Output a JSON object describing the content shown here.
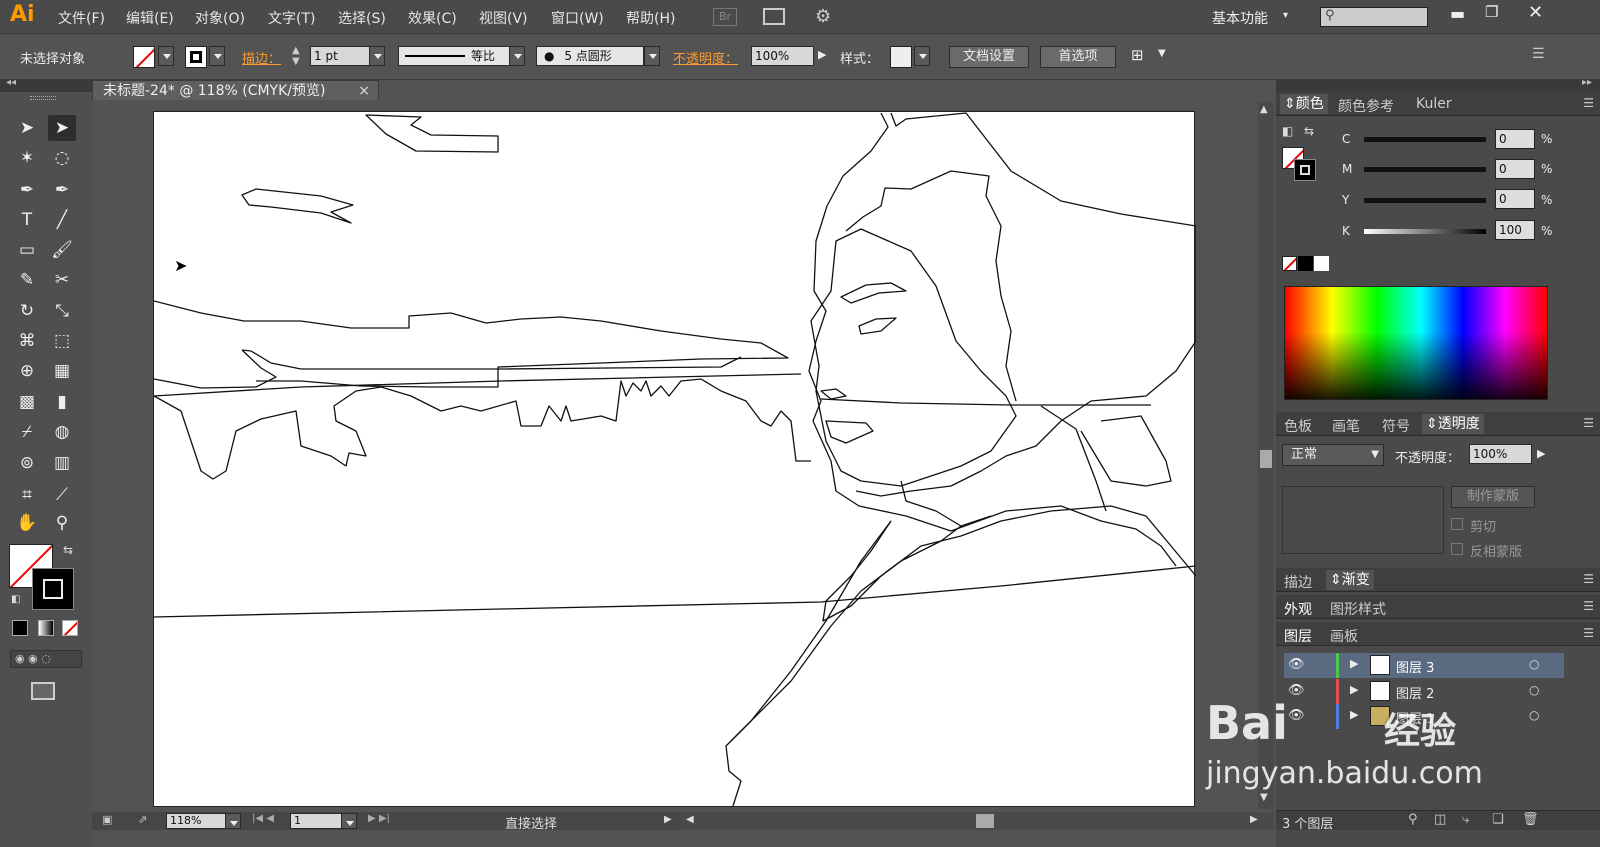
{
  "app": {
    "logo": "Ai"
  },
  "menu": [
    "文件(F)",
    "编辑(E)",
    "对象(O)",
    "文字(T)",
    "选择(S)",
    "效果(C)",
    "视图(V)",
    "窗口(W)",
    "帮助(H)"
  ],
  "menubar_right": {
    "workspace": "基本功能",
    "bridge": "Br"
  },
  "control": {
    "selection_status": "未选择对象",
    "stroke_label": "描边：",
    "stroke_weight": "1 pt",
    "profile": "等比",
    "brush": "5 点圆形",
    "opacity_label": "不透明度：",
    "opacity_value": "100%",
    "style_label": "样式：",
    "doc_setup": "文档设置",
    "preferences": "首选项"
  },
  "document": {
    "tab_title": "未标题-24* @ 118% (CMYK/预览)",
    "tab_close": "×"
  },
  "status": {
    "zoom": "118%",
    "artboard_num": "1",
    "tool_name": "直接选择"
  },
  "color_panel": {
    "tabs": [
      "颜色",
      "颜色参考",
      "Kuler"
    ],
    "channels": [
      {
        "label": "C",
        "value": "0"
      },
      {
        "label": "M",
        "value": "0"
      },
      {
        "label": "Y",
        "value": "0"
      },
      {
        "label": "K",
        "value": "100"
      }
    ],
    "percent": "%"
  },
  "transparency_panel": {
    "tabs": [
      "色板",
      "画笔",
      "符号",
      "透明度"
    ],
    "blend_mode": "正常",
    "opacity_label": "不透明度：",
    "opacity_value": "100%",
    "make_mask": "制作蒙版",
    "clip": "剪切",
    "invert_mask": "反相蒙版"
  },
  "stroke_panel": {
    "tabs": [
      "描边",
      "渐变"
    ]
  },
  "appearance_panel": {
    "tabs": [
      "外观",
      "图形样式"
    ]
  },
  "layers_panel": {
    "tabs": [
      "图层",
      "画板"
    ],
    "layers": [
      {
        "name": "图层 3",
        "color": "#4fc64f",
        "selected": true
      },
      {
        "name": "图层 2",
        "color": "#e05050",
        "selected": false
      },
      {
        "name": "图层 1",
        "color": "#4f7fe0",
        "selected": false
      }
    ],
    "count": "3 个图层"
  },
  "watermark": {
    "brand": "Bai",
    "brand_cn": "经验",
    "url": "jingyan.baidu.com"
  }
}
